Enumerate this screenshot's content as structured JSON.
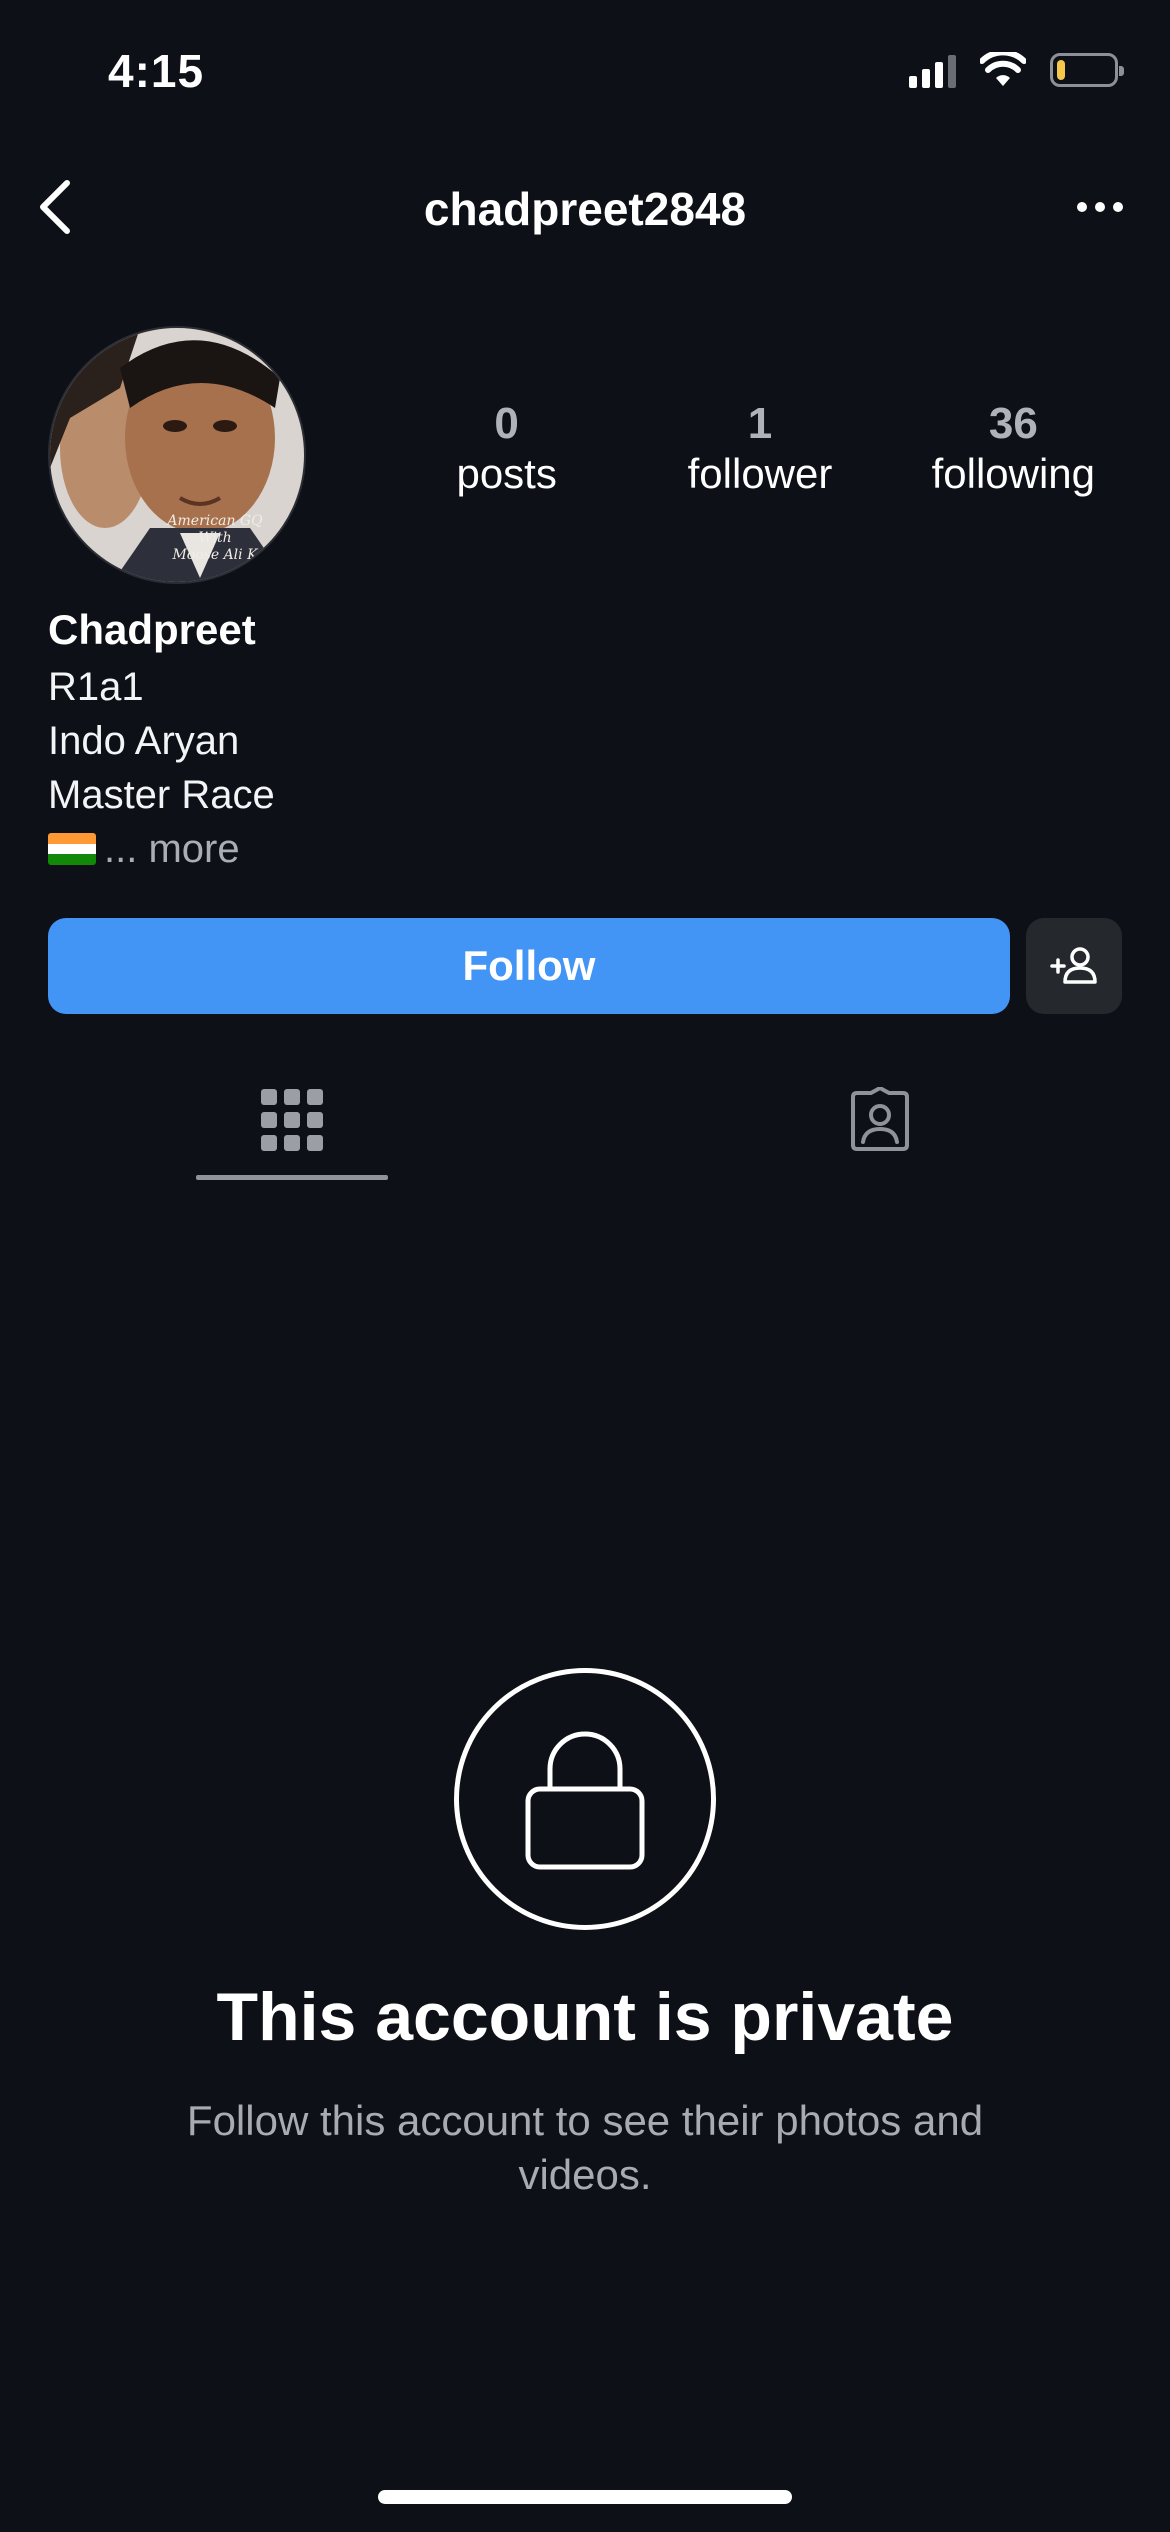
{
  "status_bar": {
    "time": "4:15",
    "icons": [
      "signal-icon",
      "wifi-icon",
      "battery-icon"
    ],
    "battery_level": 0.15
  },
  "nav": {
    "username": "chadpreet2848",
    "back_icon": "chevron-left-icon",
    "more_icon": "more-horizontal-icon"
  },
  "profile": {
    "stats": [
      {
        "count": "0",
        "label": "posts"
      },
      {
        "count": "1",
        "label": "follower"
      },
      {
        "count": "36",
        "label": "following"
      }
    ],
    "name": "Chadpreet",
    "bio_lines": [
      "R1a1",
      "Indo Aryan",
      "Master Race"
    ],
    "bio_more": "... more",
    "avatar_caption": [
      "American GQ",
      "With",
      "Moose Ali K"
    ]
  },
  "actions": {
    "follow_label": "Follow",
    "suggest_icon": "add-person-icon",
    "accent_color": "#4395f5"
  },
  "tabs": [
    {
      "icon": "grid-icon",
      "active": true
    },
    {
      "icon": "tagged-person-icon",
      "active": false
    }
  ],
  "private": {
    "icon": "lock-icon",
    "title": "This account is private",
    "subtitle": "Follow this account to see their photos and videos."
  }
}
